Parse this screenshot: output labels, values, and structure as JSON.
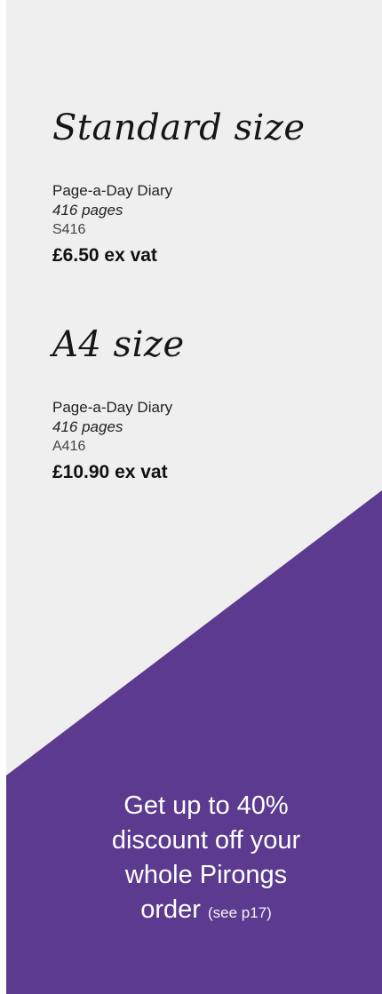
{
  "products": [
    {
      "heading": "Standard size",
      "name": "Page-a-Day Diary",
      "pages": "416 pages",
      "sku": "S416",
      "price": "£6.50 ex vat"
    },
    {
      "heading": "A4 size",
      "name": "Page-a-Day Diary",
      "pages": "416 pages",
      "sku": "A416",
      "price": "£10.90 ex vat"
    }
  ],
  "promo": {
    "line1": "Get up to 40%",
    "line2": "discount off your",
    "line3": "whole Pirongs",
    "line4": "order",
    "note": "(see p17)"
  },
  "colors": {
    "background": "#efefef",
    "accent_purple": "#5b3a8f",
    "text": "#161616"
  }
}
